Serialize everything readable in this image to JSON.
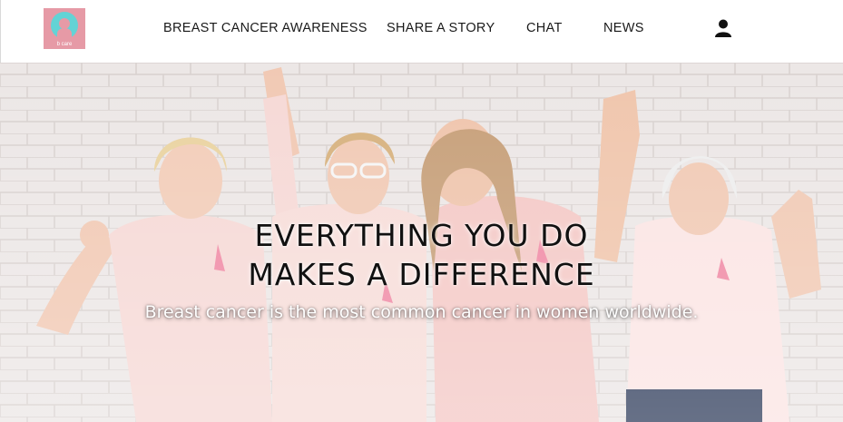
{
  "brand": {
    "logo_text": "b care",
    "logo_bg": "#e69aa6",
    "logo_accent": "#63d3d5"
  },
  "nav": {
    "items": [
      {
        "label": "BREAST CANCER AWARENESS"
      },
      {
        "label": "SHARE A STORY"
      },
      {
        "label": "CHAT"
      },
      {
        "label": "NEWS"
      }
    ],
    "account_icon": "user-icon"
  },
  "hero": {
    "headline_line1": "EVERYTHING YOU DO",
    "headline_line2": "MAKES A DIFFERENCE",
    "subheadline": "Breast cancer is the most common cancer in women worldwide.",
    "image": "photo of four smiling women in pink t-shirts with pink ribbons cheering in front of a white brick wall",
    "ribbon_color": "#f08aa5",
    "shirt_color": "#f6d9d6"
  }
}
